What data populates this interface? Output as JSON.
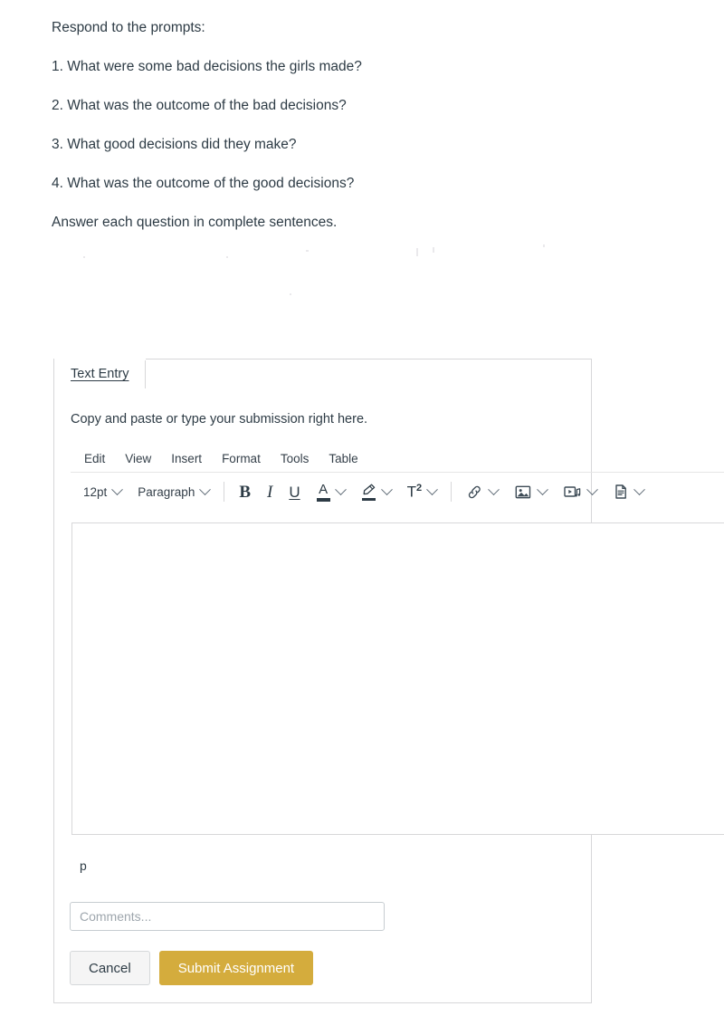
{
  "prompt": {
    "intro": "Respond to the prompts:",
    "questions": [
      "1. What were some bad decisions the girls made?",
      "2. What was the outcome of the bad decisions?",
      "3. What good decisions did they make?",
      "4. What was the outcome of the good decisions?"
    ],
    "closing": "Answer each question in complete sentences."
  },
  "submission": {
    "tab_label": "Text Entry",
    "editor_hint": "Copy and paste or type your submission right here.",
    "status_path": "p"
  },
  "editor": {
    "menus": [
      "Edit",
      "View",
      "Insert",
      "Format",
      "Tools",
      "Table"
    ],
    "font_size": "12pt",
    "block_format": "Paragraph",
    "buttons": {
      "bold": "B",
      "italic": "I",
      "underline": "U",
      "text_color": "A",
      "superscript": "T",
      "superscript_exp": "2"
    }
  },
  "comments": {
    "placeholder": "Comments..."
  },
  "actions": {
    "cancel_label": "Cancel",
    "submit_label": "Submit Assignment"
  },
  "colors": {
    "submit_gold": "#d4ac3d",
    "text": "#2d3b45",
    "border": "#d7d7d9",
    "placeholder": "#9ea6ad"
  }
}
